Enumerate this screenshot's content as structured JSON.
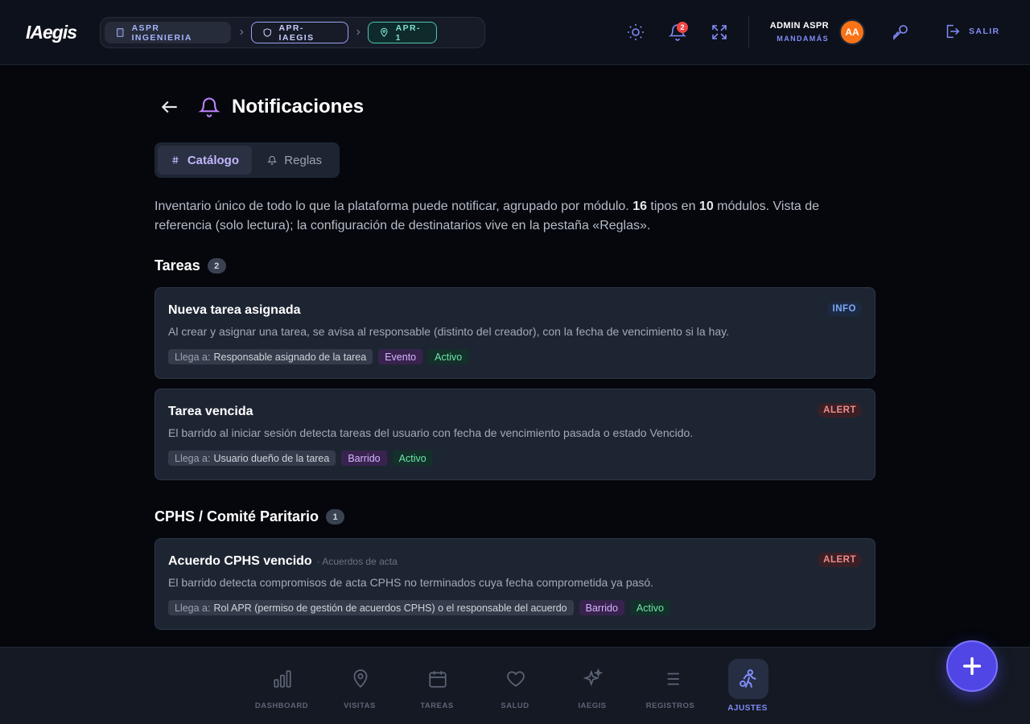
{
  "header": {
    "logo": "IAegis",
    "breadcrumbs": [
      "ASPR INGENIERIA",
      "APR-IAEGIS",
      "APR-1"
    ],
    "notification_count": "2",
    "user_name": "ADMIN ASPR",
    "user_role": "MANDAMÁS",
    "avatar_initials": "AA",
    "logout_label": "SALIR"
  },
  "page": {
    "title": "Notificaciones",
    "tabs": [
      {
        "label": "Catálogo",
        "active": true
      },
      {
        "label": "Reglas",
        "active": false
      }
    ],
    "intro": {
      "part1": "Inventario único de todo lo que la plataforma puede notificar, agrupado por módulo. ",
      "types_count": "16",
      "part2": " tipos en ",
      "modules_count": "10",
      "part3": " módulos. Vista de referencia (solo lectura); la configuración de destinatarios vive en la pestaña «Reglas»."
    }
  },
  "target_prefix": "Llega a:",
  "sections": [
    {
      "title": "Tareas",
      "count": "2",
      "cards": [
        {
          "title": "Nueva tarea asignada",
          "subtitle": "",
          "level": "INFO",
          "description": "Al crear y asignar una tarea, se avisa al responsable (distinto del creador), con la fecha de vencimiento si la hay.",
          "target": "Responsable asignado de la tarea",
          "kind": "Evento",
          "status": "Activo"
        },
        {
          "title": "Tarea vencida",
          "subtitle": "",
          "level": "ALERT",
          "description": "El barrido al iniciar sesión detecta tareas del usuario con fecha de vencimiento pasada o estado Vencido.",
          "target": "Usuario dueño de la tarea",
          "kind": "Barrido",
          "status": "Activo"
        }
      ]
    },
    {
      "title": "CPHS / Comité Paritario",
      "count": "1",
      "cards": [
        {
          "title": "Acuerdo CPHS vencido",
          "subtitle": "· Acuerdos de acta",
          "level": "ALERT",
          "description": "El barrido detecta compromisos de acta CPHS no terminados cuya fecha comprometida ya pasó.",
          "target": "Rol APR (permiso de gestión de acuerdos CPHS) o el responsable del acuerdo",
          "kind": "Barrido",
          "status": "Activo"
        }
      ]
    }
  ],
  "bottom_nav": [
    {
      "label": "DASHBOARD",
      "icon": "bar-chart-icon"
    },
    {
      "label": "VISITAS",
      "icon": "map-pin-icon"
    },
    {
      "label": "TAREAS",
      "icon": "calendar-icon"
    },
    {
      "label": "SALUD",
      "icon": "heart-icon"
    },
    {
      "label": "IAEGIS",
      "icon": "sparkles-icon"
    },
    {
      "label": "REGISTROS",
      "icon": "list-icon"
    },
    {
      "label": "AJUSTES",
      "icon": "settings-person-icon",
      "active": true
    }
  ],
  "colors": {
    "accent": "#818cf8",
    "fab": "#4f46e5",
    "alert": "#f28b8b",
    "info": "#7ea9f5"
  }
}
